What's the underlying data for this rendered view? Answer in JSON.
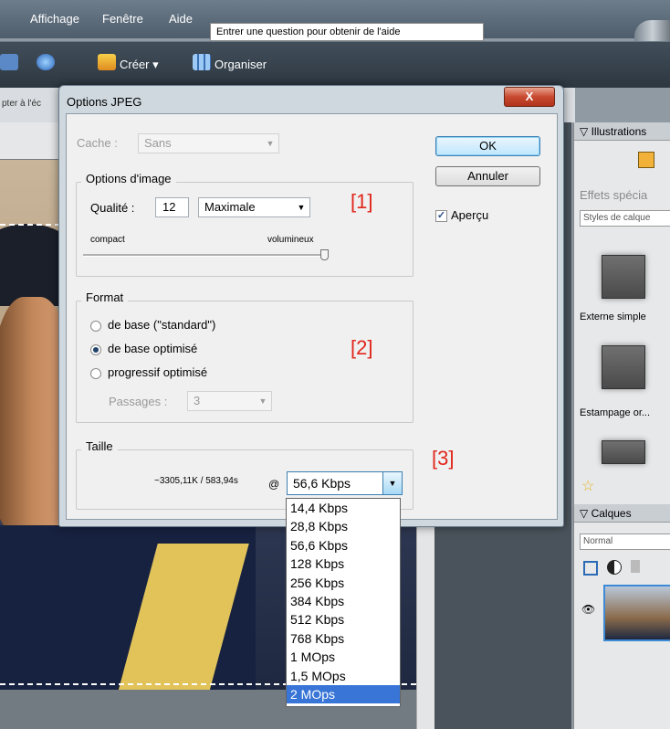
{
  "menu": {
    "items": [
      "Affichage",
      "Fenêtre",
      "Aide"
    ],
    "help_placeholder": "Entrer une question pour obtenir de l'aide"
  },
  "toolbar": {
    "create_label": "Créer ▾",
    "organize_label": "Organiser"
  },
  "fit_screen_label": "pter à l'éc",
  "dialog": {
    "title": "Options JPEG",
    "close_label": "X",
    "matte_label": "Cache :",
    "matte_value": "Sans",
    "ok_label": "OK",
    "cancel_label": "Annuler",
    "preview_label": "Aperçu",
    "preview_checked": true,
    "image_options": {
      "legend": "Options d'image",
      "quality_label": "Qualité :",
      "quality_value": "12",
      "quality_preset": "Maximale",
      "slider_min_label": "compact",
      "slider_max_label": "volumineux",
      "slider_level": 1.0
    },
    "format": {
      "legend": "Format",
      "options": [
        "de base  (\"standard\")",
        "de base optimisé",
        "progressif optimisé"
      ],
      "selected_index": 1,
      "scans_label": "Passages :",
      "scans_value": "3"
    },
    "size": {
      "legend": "Taille",
      "estimate": "~3305,11K / 583,94s",
      "at_symbol": "@",
      "speed_value": "56,6 Kbps"
    },
    "speed_options": [
      "14,4 Kbps",
      "28,8 Kbps",
      "56,6 Kbps",
      "128 Kbps",
      "256 Kbps",
      "384 Kbps",
      "512 Kbps",
      "768 Kbps",
      "1 MOps",
      "1,5 MOps",
      "2 MOps"
    ],
    "speed_highlighted_index": 10,
    "annotations": [
      "[1]",
      "[2]",
      "[3]"
    ]
  },
  "right_panel": {
    "illustrations": "Illustrations",
    "effects_title": "Effets spécia",
    "styles_select": "Styles de calque",
    "effect1_label": "Externe simple",
    "effect2_label": "Estampage or...",
    "layers_header": "Calques",
    "blend_mode": "Normal"
  },
  "colors": {
    "accent": "#3875d7",
    "annotation": "#e0261b"
  }
}
